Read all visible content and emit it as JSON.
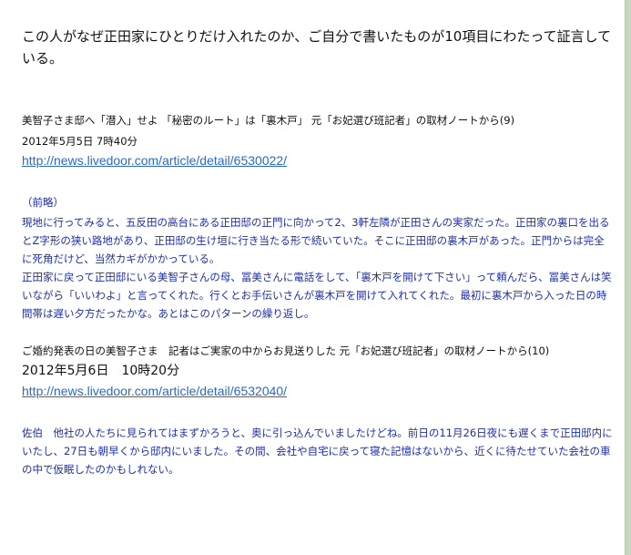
{
  "intro": "この人がなぜ正田家にひとりだけ入れたのか、ご自分で書いたものが10項目にわたって証言している。",
  "section1": {
    "title": "美智子さま邸へ「潜入」せよ 「秘密のルート」は「裏木戸」 元「お妃選び班記者」の取材ノートから(9)",
    "date": "2012年5月5日 7時40分",
    "link": "http://news.livedoor.com/article/detail/6530022/",
    "prefix": "（前略）",
    "para1": "現地に行ってみると、五反田の高台にある正田邸の正門に向かって2、3軒左隣が正田さんの実家だった。正田家の裏口を出るとZ字形の狭い路地があり、正田邸の生け垣に行き当たる形で続いていた。そこに正田邸の裏木戸があった。正門からは完全に死角だけど、当然カギがかかっている。",
    "para2": "正田家に戻って正田邸にいる美智子さんの母、冨美さんに電話をして、「裏木戸を開けて下さい」って頼んだら、冨美さんは笑いながら「いいわよ」と言ってくれた。行くとお手伝いさんが裏木戸を開けて入れてくれた。最初に裏木戸から入った日の時間帯は遅い夕方だったかな。あとはこのパターンの繰り返し。"
  },
  "section2": {
    "title": "ご婚約発表の日の美智子さま　記者はご実家の中からお見送りした 元「お妃選び班記者」の取材ノートから(10)",
    "date": "2012年5月6日　10時20分",
    "link": "http://news.livedoor.com/article/detail/6532040/",
    "para1": "佐伯　他社の人たちに見られてはまずかろうと、奥に引っ込んでいましたけどね。前日の11月26日夜にも遅くまで正田邸内にいたし、27日も朝早くから邸内にいました。その間、会社や自宅に戻って寝た記憶はないから、近くに待たせていた会社の車の中で仮眠したのかもしれない。"
  }
}
